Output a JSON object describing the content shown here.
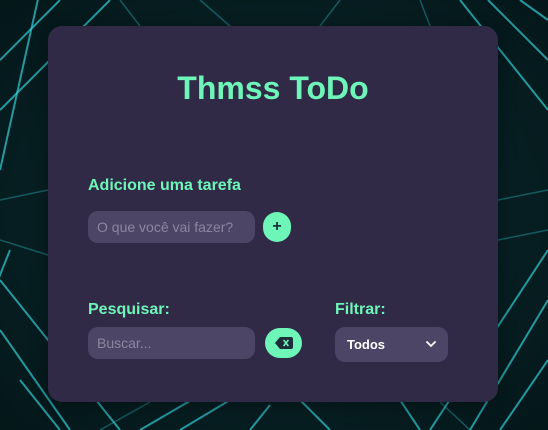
{
  "app": {
    "title": "Thmss ToDo"
  },
  "add_section": {
    "label": "Adicione uma tarefa",
    "input_placeholder": "O que você vai fazer?",
    "input_value": "",
    "add_button_label": "+"
  },
  "search_section": {
    "label": "Pesquisar:",
    "input_placeholder": "Buscar...",
    "input_value": "",
    "clear_button_icon": "backspace-icon"
  },
  "filter_section": {
    "label": "Filtrar:",
    "selected_option": "Todos",
    "dropdown_icon": "chevron-down-icon"
  },
  "colors": {
    "accent": "#6ef5b8",
    "card_background": "#302a47",
    "input_background": "#4d4566",
    "page_background": "#082226",
    "neon_lines": "#2fd0d6"
  }
}
